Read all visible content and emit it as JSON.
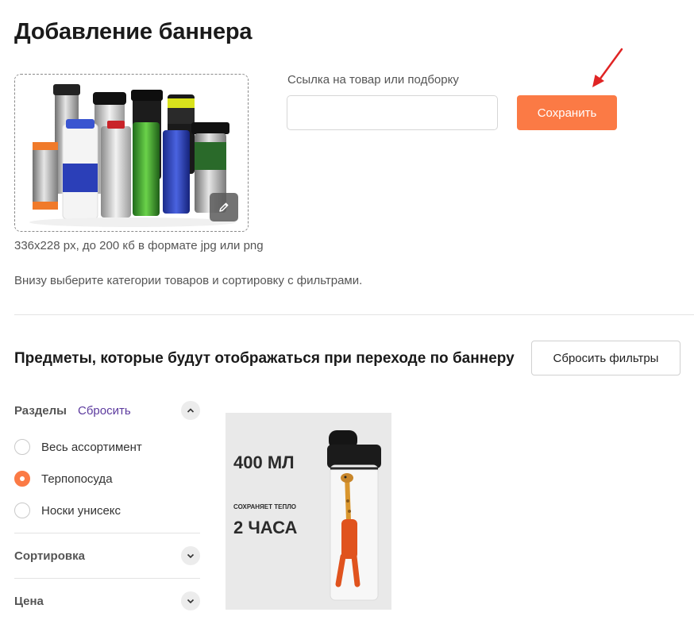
{
  "page": {
    "title": "Добавление баннера"
  },
  "banner": {
    "upload_hint": "336x228 px, до 200 кб в формате jpg или png",
    "instruction": "Внизу выберите категории товаров и сортировку с фильтрами."
  },
  "link": {
    "label": "Ссылка на товар или подборку",
    "value": "",
    "placeholder": ""
  },
  "save_label": "Сохранить",
  "section": {
    "title": "Предметы, которые будут отображаться при переходе по баннеру",
    "reset_filters_label": "Сбросить фильтры"
  },
  "filters": {
    "sections_title": "Разделы",
    "sections_reset": "Сбросить",
    "options": [
      {
        "label": "Весь ассортимент",
        "checked": false
      },
      {
        "label": "Терпопосуда",
        "checked": true
      },
      {
        "label": "Носки унисекс",
        "checked": false
      }
    ],
    "sort_title": "Сортировка",
    "price_title": "Цена"
  },
  "product": {
    "volume": "400 МЛ",
    "keeps_heat": "СОХРАНЯЕТ ТЕПЛО",
    "hours": "2 ЧАСА"
  },
  "colors": {
    "accent": "#fb7a45",
    "link": "#5c3a9e",
    "arrow": "#e02424"
  }
}
